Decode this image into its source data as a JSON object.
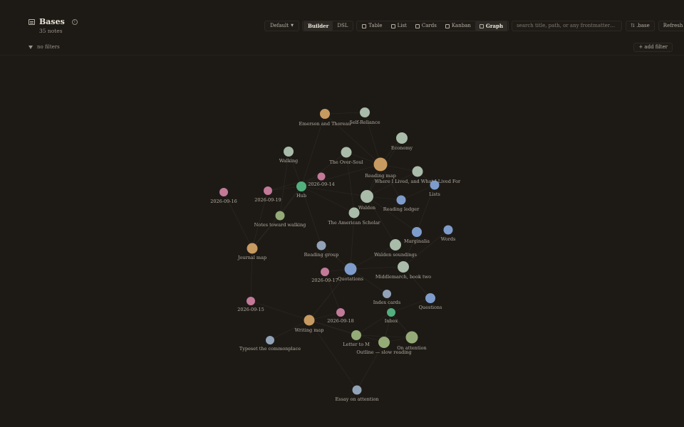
{
  "header": {
    "title": "Bases",
    "subtitle": "35 notes",
    "info_glyph": "i"
  },
  "toolbar": {
    "default_label": "Default",
    "builder_label": "Builder",
    "dsl_label": "DSL",
    "views": [
      {
        "label": "Table",
        "icon": "table-icon"
      },
      {
        "label": "List",
        "icon": "list-icon"
      },
      {
        "label": "Cards",
        "icon": "cards-icon"
      },
      {
        "label": "Kanban",
        "icon": "kanban-icon"
      },
      {
        "label": "Graph",
        "icon": "graph-icon",
        "active": true
      }
    ],
    "search_placeholder": "search title, path, or any frontmatter…",
    "base_label": "⇅ .base",
    "refresh_label": "Refresh"
  },
  "filters": {
    "status": "no filters",
    "add_label": "+ add filter"
  },
  "colors": {
    "sage": "#a9bba9",
    "tan": "#c79a61",
    "blue": "#7e9ccb",
    "pink": "#c27a98",
    "green": "#52b07e",
    "olive": "#94ab78",
    "slate": "#92a3b7"
  },
  "graph": {
    "nodes": [
      {
        "id": "emerson",
        "label": "Emerson and Thoreau",
        "color": "tan"
      },
      {
        "id": "selfreliance",
        "label": "Self-Reliance",
        "color": "sage"
      },
      {
        "id": "economy",
        "label": "Economy",
        "color": "sage"
      },
      {
        "id": "walking",
        "label": "Walking",
        "color": "sage"
      },
      {
        "id": "oversoul",
        "label": "The Over-Soul",
        "color": "sage"
      },
      {
        "id": "readingmap",
        "label": "Reading map",
        "color": "tan"
      },
      {
        "id": "wherelived",
        "label": "Where I Lived, and What I Lived For",
        "color": "sage"
      },
      {
        "id": "d0914",
        "label": "2026-09-14",
        "color": "pink"
      },
      {
        "id": "lists",
        "label": "Lists",
        "color": "blue"
      },
      {
        "id": "d0916",
        "label": "2026-09-16",
        "color": "pink"
      },
      {
        "id": "d0919",
        "label": "2026-09-19",
        "color": "pink"
      },
      {
        "id": "hub",
        "label": "Hub",
        "color": "green"
      },
      {
        "id": "walden",
        "label": "Walden",
        "color": "sage"
      },
      {
        "id": "readingledger",
        "label": "Reading ledger",
        "color": "blue"
      },
      {
        "id": "notestoward",
        "label": "Notes toward walking",
        "color": "olive"
      },
      {
        "id": "americanscholar",
        "label": "The American Scholar",
        "color": "sage"
      },
      {
        "id": "marginalia",
        "label": "Marginalia",
        "color": "blue"
      },
      {
        "id": "words",
        "label": "Words",
        "color": "blue"
      },
      {
        "id": "journalmap",
        "label": "Journal map",
        "color": "tan"
      },
      {
        "id": "readinggroup",
        "label": "Reading group",
        "color": "slate"
      },
      {
        "id": "waldensoundings",
        "label": "Walden soundings",
        "color": "sage"
      },
      {
        "id": "d0917",
        "label": "2026-09-17",
        "color": "pink"
      },
      {
        "id": "quotations",
        "label": "Quotations",
        "color": "blue"
      },
      {
        "id": "middlemarch",
        "label": "Middlemarch, book two",
        "color": "sage"
      },
      {
        "id": "indexcards",
        "label": "Index cards",
        "color": "slate"
      },
      {
        "id": "questions",
        "label": "Questions",
        "color": "blue"
      },
      {
        "id": "d0915",
        "label": "2026-09-15",
        "color": "pink"
      },
      {
        "id": "inbox",
        "label": "Inbox",
        "color": "green"
      },
      {
        "id": "d0918",
        "label": "2026-09-18",
        "color": "pink"
      },
      {
        "id": "writingmap",
        "label": "Writing map",
        "color": "tan"
      },
      {
        "id": "lettertom",
        "label": "Letter to M",
        "color": "olive"
      },
      {
        "id": "onattention",
        "label": "On attention",
        "color": "olive"
      },
      {
        "id": "typeset",
        "label": "Typeset the commonplace",
        "color": "slate"
      },
      {
        "id": "outline",
        "label": "Outline — slow reading",
        "color": "olive"
      },
      {
        "id": "essay",
        "label": "Essay on attention",
        "color": "slate"
      }
    ],
    "edges": [
      [
        "hub",
        "readingmap"
      ],
      [
        "hub",
        "walden"
      ],
      [
        "hub",
        "oversoul"
      ],
      [
        "hub",
        "walking"
      ],
      [
        "hub",
        "emerson"
      ],
      [
        "hub",
        "d0914"
      ],
      [
        "hub",
        "d0919"
      ],
      [
        "hub",
        "notestoward"
      ],
      [
        "hub",
        "readinggroup"
      ],
      [
        "hub",
        "americanscholar"
      ],
      [
        "hub",
        "journalmap"
      ],
      [
        "readingmap",
        "walden"
      ],
      [
        "readingmap",
        "economy"
      ],
      [
        "readingmap",
        "selfreliance"
      ],
      [
        "readingmap",
        "wherelived"
      ],
      [
        "readingmap",
        "readingledger"
      ],
      [
        "readingmap",
        "oversoul"
      ],
      [
        "readingmap",
        "emerson"
      ],
      [
        "walden",
        "economy"
      ],
      [
        "walden",
        "wherelived"
      ],
      [
        "walden",
        "americanscholar"
      ],
      [
        "walden",
        "waldensoundings"
      ],
      [
        "walden",
        "marginalia"
      ],
      [
        "walden",
        "readingledger"
      ],
      [
        "quotations",
        "readinggroup"
      ],
      [
        "quotations",
        "middlemarch"
      ],
      [
        "quotations",
        "indexcards"
      ],
      [
        "quotations",
        "d0917"
      ],
      [
        "quotations",
        "writingmap"
      ],
      [
        "quotations",
        "waldensoundings"
      ],
      [
        "quotations",
        "americanscholar"
      ],
      [
        "writingmap",
        "lettertom"
      ],
      [
        "writingmap",
        "outline"
      ],
      [
        "writingmap",
        "typeset"
      ],
      [
        "writingmap",
        "d0918"
      ],
      [
        "writingmap",
        "d0915"
      ],
      [
        "writingmap",
        "essay"
      ],
      [
        "inbox",
        "indexcards"
      ],
      [
        "inbox",
        "outline"
      ],
      [
        "inbox",
        "onattention"
      ],
      [
        "inbox",
        "lettertom"
      ],
      [
        "inbox",
        "questions"
      ],
      [
        "middlemarch",
        "marginalia"
      ],
      [
        "middlemarch",
        "words"
      ],
      [
        "middlemarch",
        "questions"
      ],
      [
        "lists",
        "wherelived"
      ],
      [
        "lists",
        "marginalia"
      ],
      [
        "lists",
        "readingledger"
      ],
      [
        "outline",
        "essay"
      ],
      [
        "outline",
        "onattention"
      ],
      [
        "lettertom",
        "onattention"
      ],
      [
        "journalmap",
        "d0916"
      ],
      [
        "journalmap",
        "d0919"
      ],
      [
        "journalmap",
        "d0915"
      ],
      [
        "journalmap",
        "notestoward"
      ],
      [
        "d0914",
        "d0919"
      ],
      [
        "d0917",
        "d0918"
      ],
      [
        "emerson",
        "selfreliance"
      ],
      [
        "oversoul",
        "americanscholar"
      ],
      [
        "walking",
        "notestoward"
      ]
    ]
  }
}
